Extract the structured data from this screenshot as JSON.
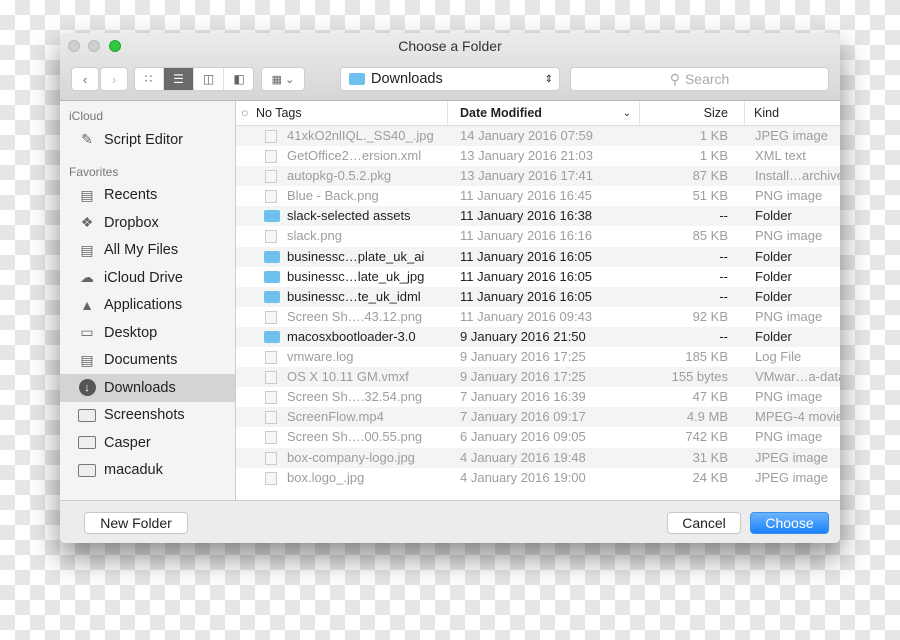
{
  "window": {
    "title": "Choose a Folder"
  },
  "toolbar": {
    "back_icon": "chevron-left-icon",
    "forward_icon": "chevron-right-icon",
    "location": "Downloads",
    "search_placeholder": "Search"
  },
  "sidebar": {
    "sections": [
      {
        "header": "iCloud",
        "items": [
          {
            "label": "Script Editor",
            "icon": "script-editor-icon"
          }
        ]
      },
      {
        "header": "Favorites",
        "items": [
          {
            "label": "Recents",
            "icon": "recents-icon"
          },
          {
            "label": "Dropbox",
            "icon": "dropbox-icon"
          },
          {
            "label": "All My Files",
            "icon": "all-files-icon"
          },
          {
            "label": "iCloud Drive",
            "icon": "cloud-icon"
          },
          {
            "label": "Applications",
            "icon": "applications-icon"
          },
          {
            "label": "Desktop",
            "icon": "desktop-icon"
          },
          {
            "label": "Documents",
            "icon": "documents-icon"
          },
          {
            "label": "Downloads",
            "icon": "downloads-icon",
            "selected": true
          },
          {
            "label": "Screenshots",
            "icon": "folder-icon"
          },
          {
            "label": "Casper",
            "icon": "folder-icon"
          },
          {
            "label": "macaduk",
            "icon": "folder-icon"
          }
        ]
      }
    ]
  },
  "columns": {
    "name": "No Tags",
    "date": "Date Modified",
    "size": "Size",
    "kind": "Kind"
  },
  "files": [
    {
      "name": "41xkO2nlIQL._SS40_.jpg",
      "date": "14 January 2016 07:59",
      "size": "1 KB",
      "kind": "JPEG image",
      "folder": false
    },
    {
      "name": "GetOffice2…ersion.xml",
      "date": "13 January 2016 21:03",
      "size": "1 KB",
      "kind": "XML text",
      "folder": false
    },
    {
      "name": "autopkg-0.5.2.pkg",
      "date": "13 January 2016 17:41",
      "size": "87 KB",
      "kind": "Install…archive",
      "folder": false
    },
    {
      "name": "Blue - Back.png",
      "date": "11 January 2016 16:45",
      "size": "51 KB",
      "kind": "PNG image",
      "folder": false
    },
    {
      "name": "slack-selected assets",
      "date": "11 January 2016 16:38",
      "size": "--",
      "kind": "Folder",
      "folder": true
    },
    {
      "name": "slack.png",
      "date": "11 January 2016 16:16",
      "size": "85 KB",
      "kind": "PNG image",
      "folder": false
    },
    {
      "name": "businessc…plate_uk_ai",
      "date": "11 January 2016 16:05",
      "size": "--",
      "kind": "Folder",
      "folder": true
    },
    {
      "name": "businessc…late_uk_jpg",
      "date": "11 January 2016 16:05",
      "size": "--",
      "kind": "Folder",
      "folder": true
    },
    {
      "name": "businessc…te_uk_idml",
      "date": "11 January 2016 16:05",
      "size": "--",
      "kind": "Folder",
      "folder": true
    },
    {
      "name": "Screen Sh….43.12.png",
      "date": "11 January 2016 09:43",
      "size": "92 KB",
      "kind": "PNG image",
      "folder": false
    },
    {
      "name": "macosxbootloader-3.0",
      "date": "9 January 2016 21:50",
      "size": "--",
      "kind": "Folder",
      "folder": true
    },
    {
      "name": "vmware.log",
      "date": "9 January 2016 17:25",
      "size": "185 KB",
      "kind": "Log File",
      "folder": false
    },
    {
      "name": "OS X 10.11 GM.vmxf",
      "date": "9 January 2016 17:25",
      "size": "155 bytes",
      "kind": "VMwar…a-data",
      "folder": false
    },
    {
      "name": "Screen Sh….32.54.png",
      "date": "7 January 2016 16:39",
      "size": "47 KB",
      "kind": "PNG image",
      "folder": false
    },
    {
      "name": "ScreenFlow.mp4",
      "date": "7 January 2016 09:17",
      "size": "4.9 MB",
      "kind": "MPEG-4 movie",
      "folder": false
    },
    {
      "name": "Screen Sh….00.55.png",
      "date": "6 January 2016 09:05",
      "size": "742 KB",
      "kind": "PNG image",
      "folder": false
    },
    {
      "name": "box-company-logo.jpg",
      "date": "4 January 2016 19:48",
      "size": "31 KB",
      "kind": "JPEG image",
      "folder": false
    },
    {
      "name": "box.logo_.jpg",
      "date": "4 January 2016 19:00",
      "size": "24 KB",
      "kind": "JPEG image",
      "folder": false
    }
  ],
  "footer": {
    "new_folder": "New Folder",
    "cancel": "Cancel",
    "choose": "Choose"
  },
  "colors": {
    "accent": "#1a82fb",
    "folder": "#6ec1ef",
    "selection": "#d4d4d4"
  }
}
